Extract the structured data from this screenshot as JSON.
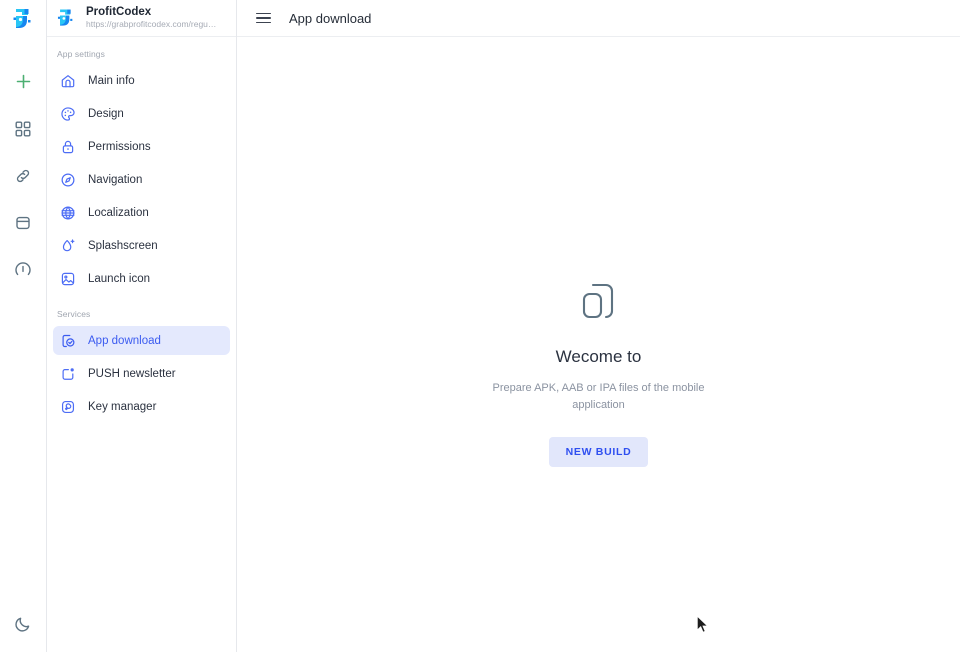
{
  "rail": {
    "logo_icon": "app-logo-icon",
    "items": [
      {
        "icon": "plus-icon",
        "name": "rail-add-button"
      },
      {
        "icon": "grid-icon",
        "name": "rail-apps-button"
      },
      {
        "icon": "link-icon",
        "name": "rail-links-button"
      },
      {
        "icon": "database-icon",
        "name": "rail-database-button"
      },
      {
        "icon": "gauge-icon",
        "name": "rail-status-button"
      }
    ],
    "bottom": {
      "icon": "moon-icon",
      "name": "rail-dark-mode-toggle"
    }
  },
  "sidebar": {
    "project": {
      "name": "ProfitCodex",
      "url": "https://grabprofitcodex.com/regu…",
      "logo_icon": "project-logo-icon"
    },
    "sections": [
      {
        "label": "App settings",
        "items": [
          {
            "label": "Main info",
            "icon": "home-icon",
            "active": false
          },
          {
            "label": "Design",
            "icon": "palette-icon",
            "active": false
          },
          {
            "label": "Permissions",
            "icon": "lock-icon",
            "active": false
          },
          {
            "label": "Navigation",
            "icon": "compass-icon",
            "active": false
          },
          {
            "label": "Localization",
            "icon": "globe-icon",
            "active": false
          },
          {
            "label": "Splashscreen",
            "icon": "splash-icon",
            "active": false
          },
          {
            "label": "Launch icon",
            "icon": "image-icon",
            "active": false
          }
        ]
      },
      {
        "label": "Services",
        "items": [
          {
            "label": "App download",
            "icon": "app-download-icon",
            "active": true
          },
          {
            "label": "PUSH newsletter",
            "icon": "push-newsletter-icon",
            "active": false
          },
          {
            "label": "Key manager",
            "icon": "key-manager-icon",
            "active": false
          }
        ]
      }
    ]
  },
  "topbar": {
    "menu_icon": "hamburger-menu-icon",
    "title": "App download"
  },
  "empty_state": {
    "icon": "app-builds-icon",
    "title": "Wecome to",
    "subtitle": "Prepare APK, AAB or IPA files of the mobile application",
    "button_label": "NEW BUILD"
  },
  "colors": {
    "accent_blue": "#3b5bf0",
    "accent_blue_soft": "#e4e9fd",
    "button_bg": "#e2e7fb",
    "button_text": "#2f4ff0",
    "icon_slate": "#5e7382",
    "text_primary": "#2b3240",
    "text_muted": "#8b93a1",
    "plus_green": "#4caf72",
    "logo_blue": "#1787f0",
    "logo_cyan": "#29c6f5",
    "border": "#e6e8ec"
  }
}
